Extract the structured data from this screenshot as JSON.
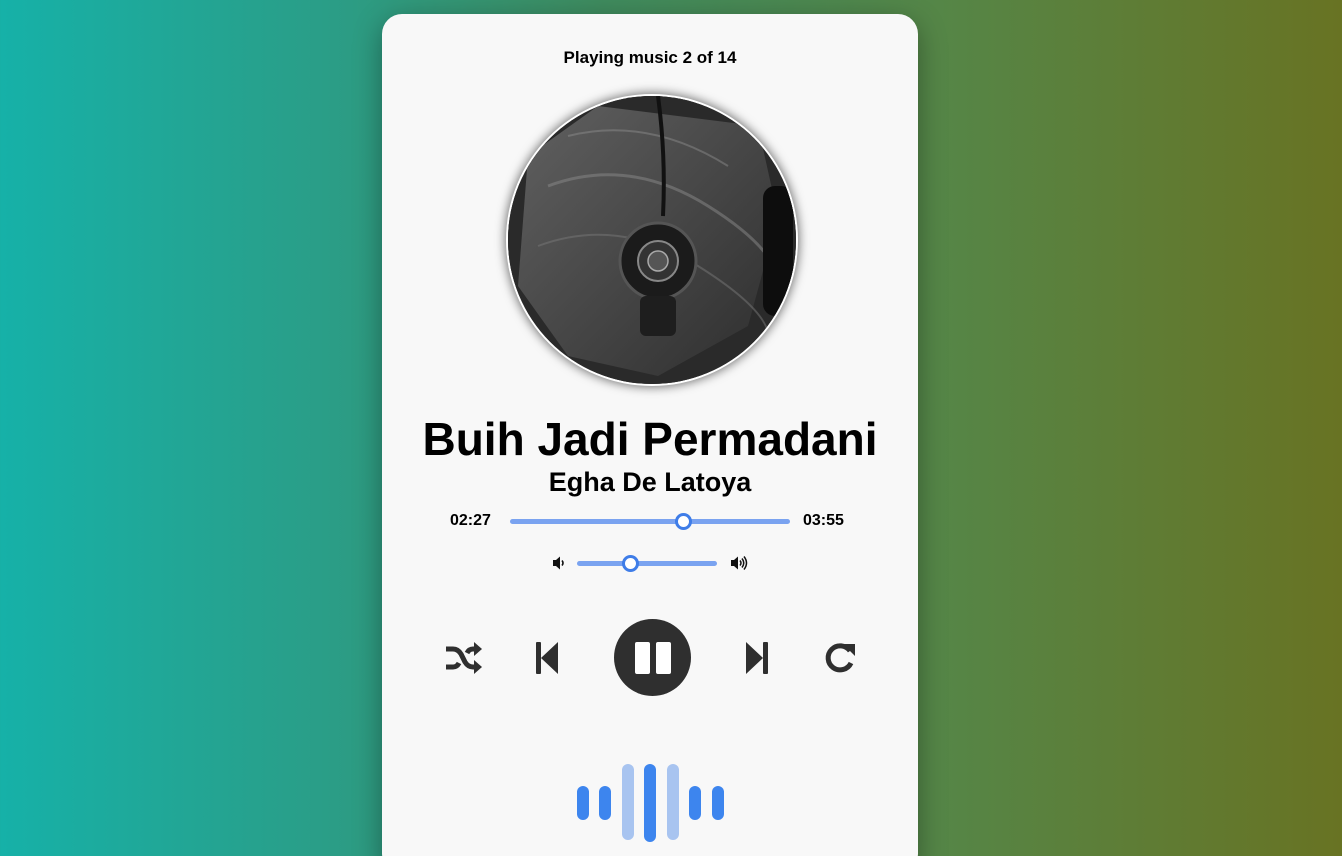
{
  "player": {
    "playing_text": "Playing music 2 of 14",
    "song_title": "Buih Jadi Permadani",
    "artist": "Egha De Latoya",
    "current_time": "02:27",
    "duration": "03:55",
    "progress_fraction": 0.62,
    "volume_fraction": 0.38
  },
  "controls": {
    "shuffle_icon": "shuffle-icon",
    "previous_icon": "skip-previous-icon",
    "pause_icon": "pause-icon",
    "next_icon": "skip-next-icon",
    "repeat_icon": "repeat-icon",
    "volume_low_icon": "volume-low-icon",
    "volume_high_icon": "volume-high-icon"
  },
  "colors": {
    "slider_track": "#7aa3f0",
    "slider_thumb": "#3f7de8",
    "play_button": "#2f2f2f",
    "visualizer_dark": "#3d85ee",
    "visualizer_light": "#a8c4f0"
  }
}
